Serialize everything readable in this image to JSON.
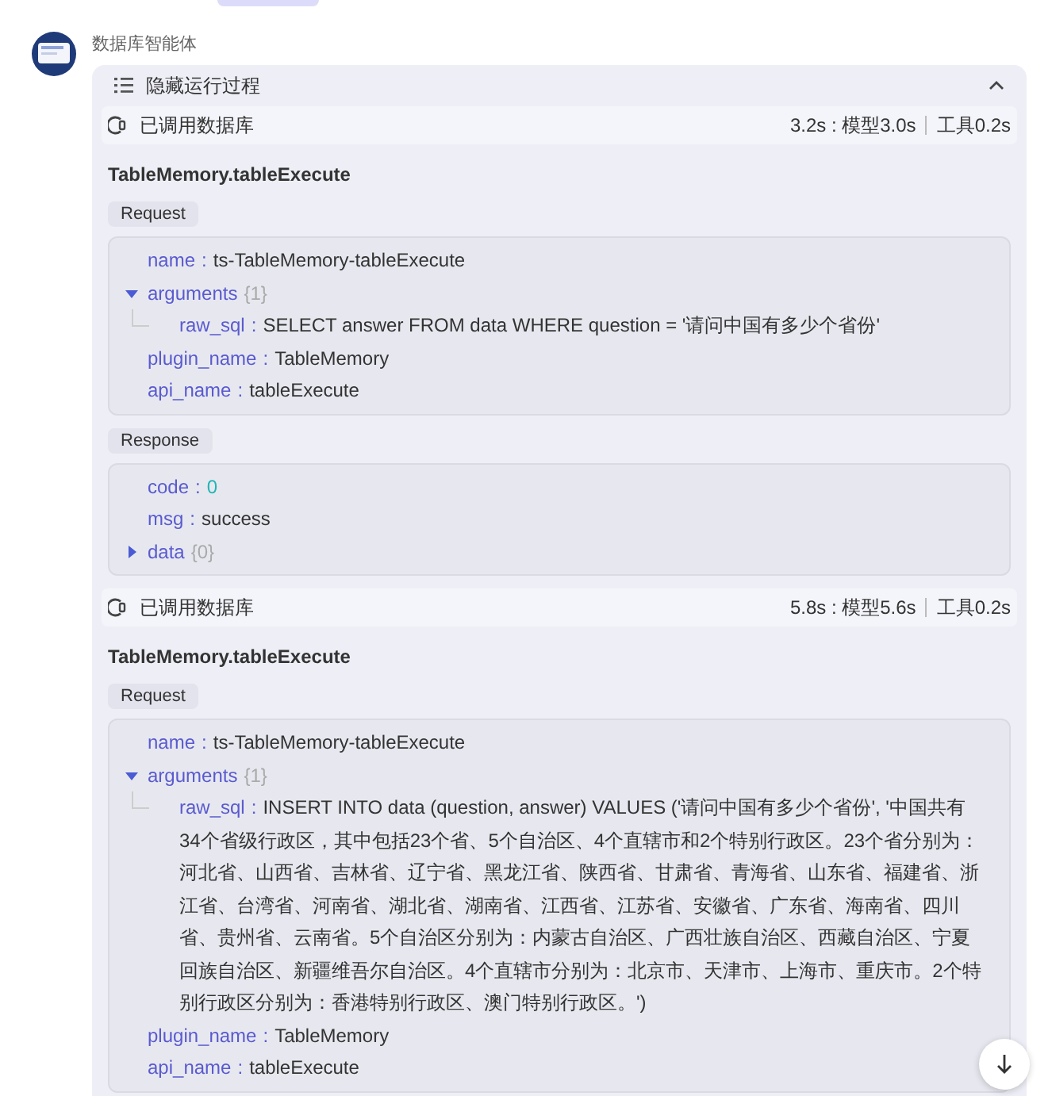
{
  "agent": {
    "name": "数据库智能体"
  },
  "process": {
    "label": "隐藏运行过程",
    "expanded": true
  },
  "calls": [
    {
      "status": "已调用数据库",
      "total": "3.2s : 模型3.0s",
      "tool_time": "工具0.2s",
      "function": "TableMemory.tableExecute",
      "request_label": "Request",
      "request": [
        {
          "kind": "string",
          "key": "name",
          "colon": ":",
          "value": "ts-TableMemory-tableExecute"
        },
        {
          "kind": "object",
          "key": "arguments",
          "count": "{1}",
          "expanded": true,
          "children": [
            {
              "key": "raw_sql",
              "colon": ":",
              "value": "SELECT answer FROM data WHERE question = '请问中国有多少个省份'"
            }
          ]
        },
        {
          "kind": "string",
          "key": "plugin_name",
          "colon": ":",
          "value": "TableMemory"
        },
        {
          "kind": "string",
          "key": "api_name",
          "colon": ":",
          "value": "tableExecute"
        }
      ],
      "response_label": "Response",
      "response": [
        {
          "kind": "number",
          "key": "code",
          "colon": ":",
          "value": "0"
        },
        {
          "kind": "string",
          "key": "msg",
          "colon": ":",
          "value": "success"
        },
        {
          "kind": "object",
          "key": "data",
          "count": "{0}",
          "expanded": false
        }
      ]
    },
    {
      "status": "已调用数据库",
      "total": "5.8s : 模型5.6s",
      "tool_time": "工具0.2s",
      "function": "TableMemory.tableExecute",
      "request_label": "Request",
      "request": [
        {
          "kind": "string",
          "key": "name",
          "colon": ":",
          "value": "ts-TableMemory-tableExecute"
        },
        {
          "kind": "object",
          "key": "arguments",
          "count": "{1}",
          "expanded": true,
          "children": [
            {
              "key": "raw_sql",
              "colon": ":",
              "value": "INSERT INTO data (question, answer) VALUES ('请问中国有多少个省份', '中国共有34个省级行政区，其中包括23个省、5个自治区、4个直辖市和2个特别行政区。23个省分别为：河北省、山西省、吉林省、辽宁省、黑龙江省、陕西省、甘肃省、青海省、山东省、福建省、浙江省、台湾省、河南省、湖北省、湖南省、江西省、江苏省、安徽省、广东省、海南省、四川省、贵州省、云南省。5个自治区分别为：内蒙古自治区、广西壮族自治区、西藏自治区、宁夏回族自治区、新疆维吾尔自治区。4个直辖市分别为：北京市、天津市、上海市、重庆市。2个特别行政区分别为：香港特别行政区、澳门特别行政区。')"
            }
          ]
        },
        {
          "kind": "string",
          "key": "plugin_name",
          "colon": ":",
          "value": "TableMemory"
        },
        {
          "kind": "string",
          "key": "api_name",
          "colon": ":",
          "value": "tableExecute"
        }
      ]
    }
  ]
}
